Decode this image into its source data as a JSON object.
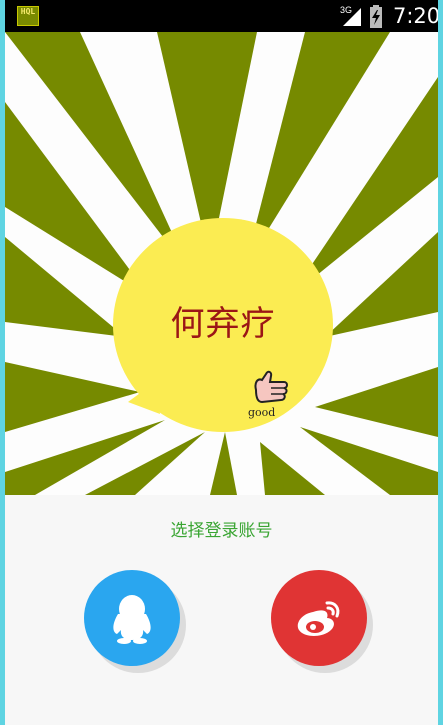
{
  "status_bar": {
    "app_icon_label": "HQL",
    "network_label": "3G",
    "time": "7:20"
  },
  "banner": {
    "app_name": "何弃疗",
    "sticker_text": "good"
  },
  "login": {
    "prompt": "选择登录账号",
    "options": [
      {
        "name": "QQ",
        "icon": "qq-penguin-icon"
      },
      {
        "name": "Weibo",
        "icon": "weibo-icon"
      }
    ]
  },
  "colors": {
    "sunburst": "#768a00",
    "bubble": "#fbec52",
    "title": "#9b1616",
    "prompt": "#3aa533",
    "qq": "#2aa6ef",
    "weibo": "#e03434"
  }
}
